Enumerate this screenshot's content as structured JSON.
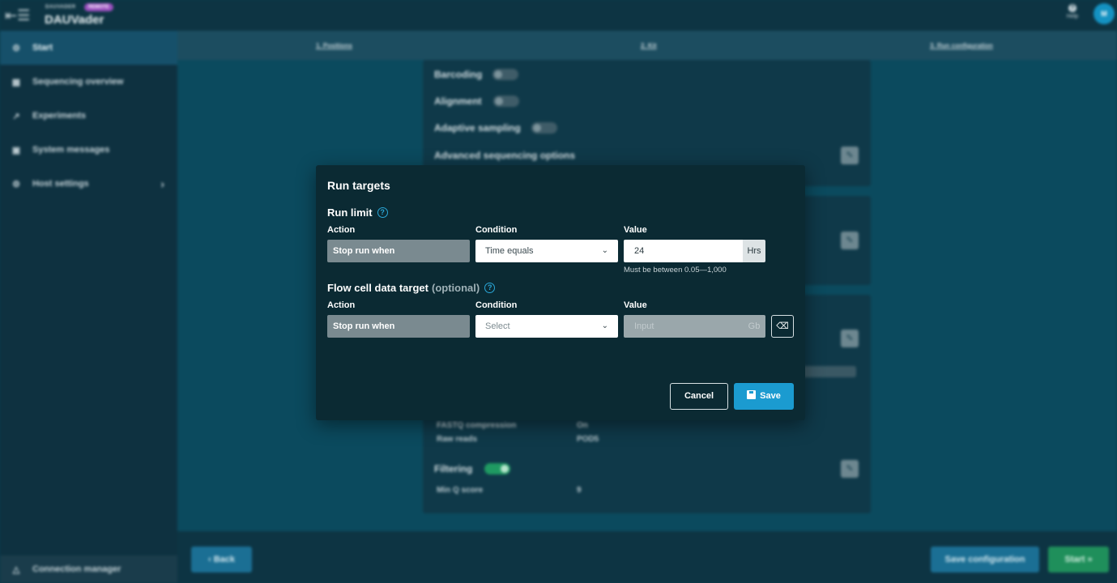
{
  "app": {
    "brand_small": "DAUVADER",
    "badge": "REMOTE",
    "title": "DAUVader",
    "help_label": "Help",
    "avatar_initial": "M"
  },
  "sidebar": {
    "items": [
      {
        "label": "Start",
        "icon": "gear-icon"
      },
      {
        "label": "Sequencing overview",
        "icon": "grid-icon"
      },
      {
        "label": "Experiments",
        "icon": "chart-line-icon"
      },
      {
        "label": "System messages",
        "icon": "message-icon"
      },
      {
        "label": "Host settings",
        "icon": "gear-icon"
      }
    ],
    "bottom": {
      "label": "Connection manager",
      "icon": "network-icon"
    }
  },
  "steps": [
    "1. Positions",
    "2. Kit",
    "3. Run configuration"
  ],
  "background": {
    "barcoding": "Barcoding",
    "alignment": "Alignment",
    "adaptive": "Adaptive sampling",
    "advanced": "Advanced sequencing options",
    "fastq_label": "FASTQ compression",
    "fastq_value": "On",
    "raw_label": "Raw reads",
    "raw_value": "POD5",
    "filtering": "Filtering",
    "minq_label": "Min Q score",
    "minq_value": "9"
  },
  "footer": {
    "back": "Back",
    "save_configuration": "Save configuration",
    "start": "Start"
  },
  "modal": {
    "title": "Run targets",
    "run_limit": {
      "heading": "Run limit",
      "action_label": "Action",
      "condition_label": "Condition",
      "value_label": "Value",
      "action_value": "Stop run when",
      "condition_value": "Time equals",
      "value": "24",
      "unit": "Hrs",
      "hint": "Must be between 0.05—1,000"
    },
    "flow_cell": {
      "heading": "Flow cell data target",
      "optional": "(optional)",
      "action_label": "Action",
      "condition_label": "Condition",
      "value_label": "Value",
      "action_value": "Stop run when",
      "condition_placeholder": "Select",
      "value_placeholder": "Input",
      "unit": "Gb"
    },
    "cancel": "Cancel",
    "save": "Save"
  }
}
